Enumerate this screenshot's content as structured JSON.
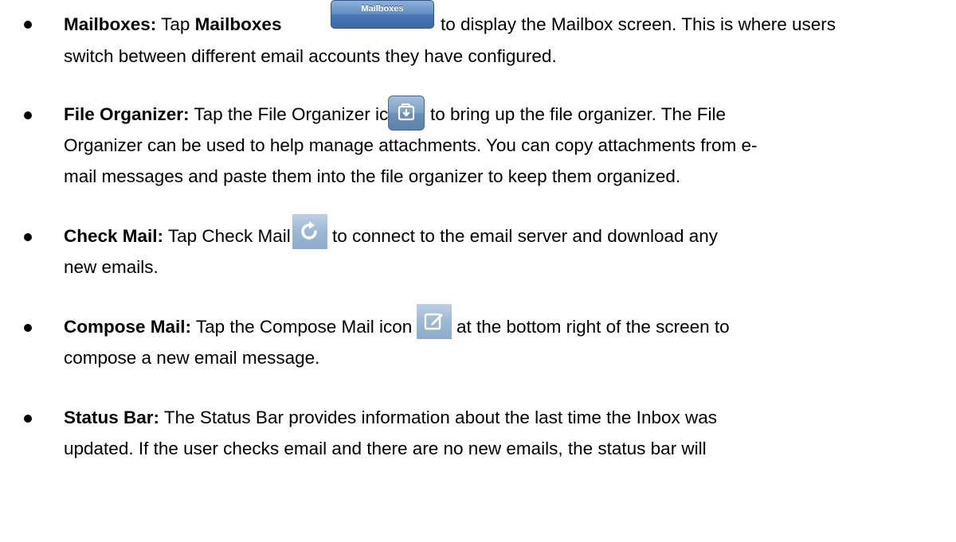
{
  "items": [
    {
      "term": "Mailboxes:",
      "line1_a": "Tap ",
      "line1_bold": "Mailboxes",
      "button_label": "Mailboxes",
      "line1_b": " to display the Mailbox screen.  This is where users",
      "line2": "switch between different email accounts they have configured."
    },
    {
      "term": "File Organizer:",
      "line1_a": " Tap the File Organizer icon ",
      "icon": "file-organizer-icon",
      "line1_b": " to bring up the file organizer.  The File",
      "line2": "Organizer can be used to help manage attachments. You can copy attachments from e-",
      "line3": "mail messages and paste them into the file organizer to keep them organized."
    },
    {
      "term": "Check Mail:",
      "line1_a": " Tap Check Mail icon ",
      "icon": "refresh-icon",
      "line1_b": " to connect to the email server and download any",
      "line2": "new emails."
    },
    {
      "term": "Compose Mail:",
      "line1_a": " Tap the Compose Mail icon ",
      "icon": "compose-icon",
      "line1_b": " at the bottom right of the screen to",
      "line2": "compose a new email message."
    },
    {
      "term": "Status Bar:",
      "line1_a": " The Status Bar provides information about the last time the Inbox was",
      "line2": "updated.  If the user checks email and there are no new emails, the status bar will"
    }
  ],
  "colors": {
    "text": "#000000",
    "icon_blue": "#5f8bc2"
  }
}
